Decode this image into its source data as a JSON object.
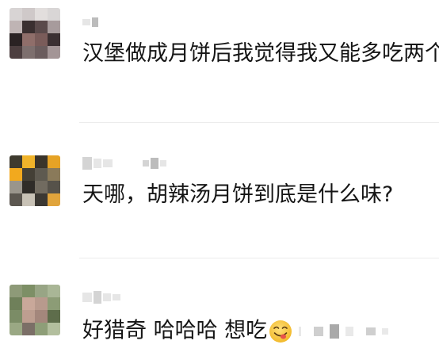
{
  "comments": [
    {
      "text": "汉堡做成月饼后我觉得我又能多吃两个"
    },
    {
      "text": "天哪，胡辣汤月饼到底是什么味?"
    },
    {
      "text_parts": [
        "好猎奇",
        "哈哈哈",
        "想吃"
      ],
      "emoji": "smiling-tongue-emoji"
    }
  ],
  "colors": {
    "text": "#151515",
    "divider": "#ececec",
    "emoji_face": "#f7c538",
    "emoji_tongue": "#e8534a",
    "pixelated_name": "#d4d4d4"
  }
}
